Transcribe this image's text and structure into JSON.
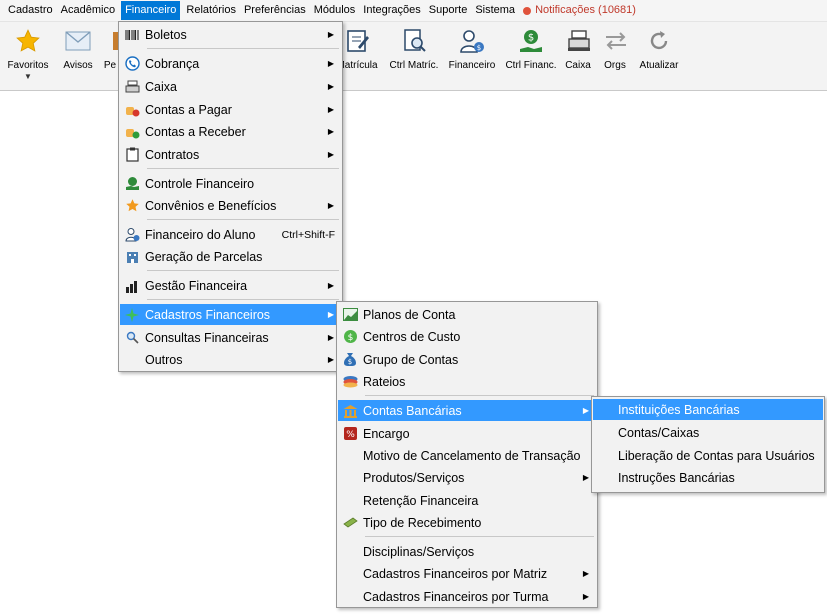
{
  "menubar": {
    "items": [
      "Cadastro",
      "Acadêmico",
      "Financeiro",
      "Relatórios",
      "Preferências",
      "Módulos",
      "Integrações",
      "Suporte",
      "Sistema"
    ],
    "notifications": "Notificações (10681)"
  },
  "toolbar": {
    "favoritos": "Favoritos",
    "avisos": "Avisos",
    "pe": "Pe",
    "matricula": "Matrícula",
    "ctrl_matric": "Ctrl Matríc.",
    "financeiro": "Financeiro",
    "ctrl_financ": "Ctrl Financ.",
    "caixa": "Caixa",
    "orgs": "Orgs",
    "atualizar": "Atualizar"
  },
  "financeiro_menu": {
    "boletos": "Boletos",
    "cobranca": "Cobrança",
    "caixa": "Caixa",
    "contas_pagar": "Contas a Pagar",
    "contas_receber": "Contas a Receber",
    "contratos": "Contratos",
    "controle_financeiro": "Controle Financeiro",
    "convenios": "Convênios e Benefícios",
    "financeiro_aluno": "Financeiro do Aluno",
    "financeiro_aluno_shortcut": "Ctrl+Shift-F",
    "geracao_parcelas": "Geração de Parcelas",
    "gestao_financeira": "Gestão Financeira",
    "cadastros_financeiros": "Cadastros Financeiros",
    "consultas_financeiras": "Consultas Financeiras",
    "outros": "Outros"
  },
  "cadastros_menu": {
    "planos_conta": "Planos de Conta",
    "centros_custo": "Centros de Custo",
    "grupo_contas": "Grupo de Contas",
    "rateios": "Rateios",
    "contas_bancarias": "Contas Bancárias",
    "encargo": "Encargo",
    "motivo_cancelamento": "Motivo de Cancelamento de Transação",
    "produtos_servicos": "Produtos/Serviços",
    "retencao_financeira": "Retenção Financeira",
    "tipo_recebimento": "Tipo de Recebimento",
    "disciplinas_servicos": "Disciplinas/Serviços",
    "cad_fin_matriz": "Cadastros Financeiros por Matriz",
    "cad_fin_turma": "Cadastros Financeiros por Turma"
  },
  "contas_menu": {
    "instituicoes": "Instituições Bancárias",
    "contas_caixas": "Contas/Caixas",
    "liberacao": "Liberação de Contas para Usuários",
    "instrucoes": "Instruções Bancárias"
  }
}
